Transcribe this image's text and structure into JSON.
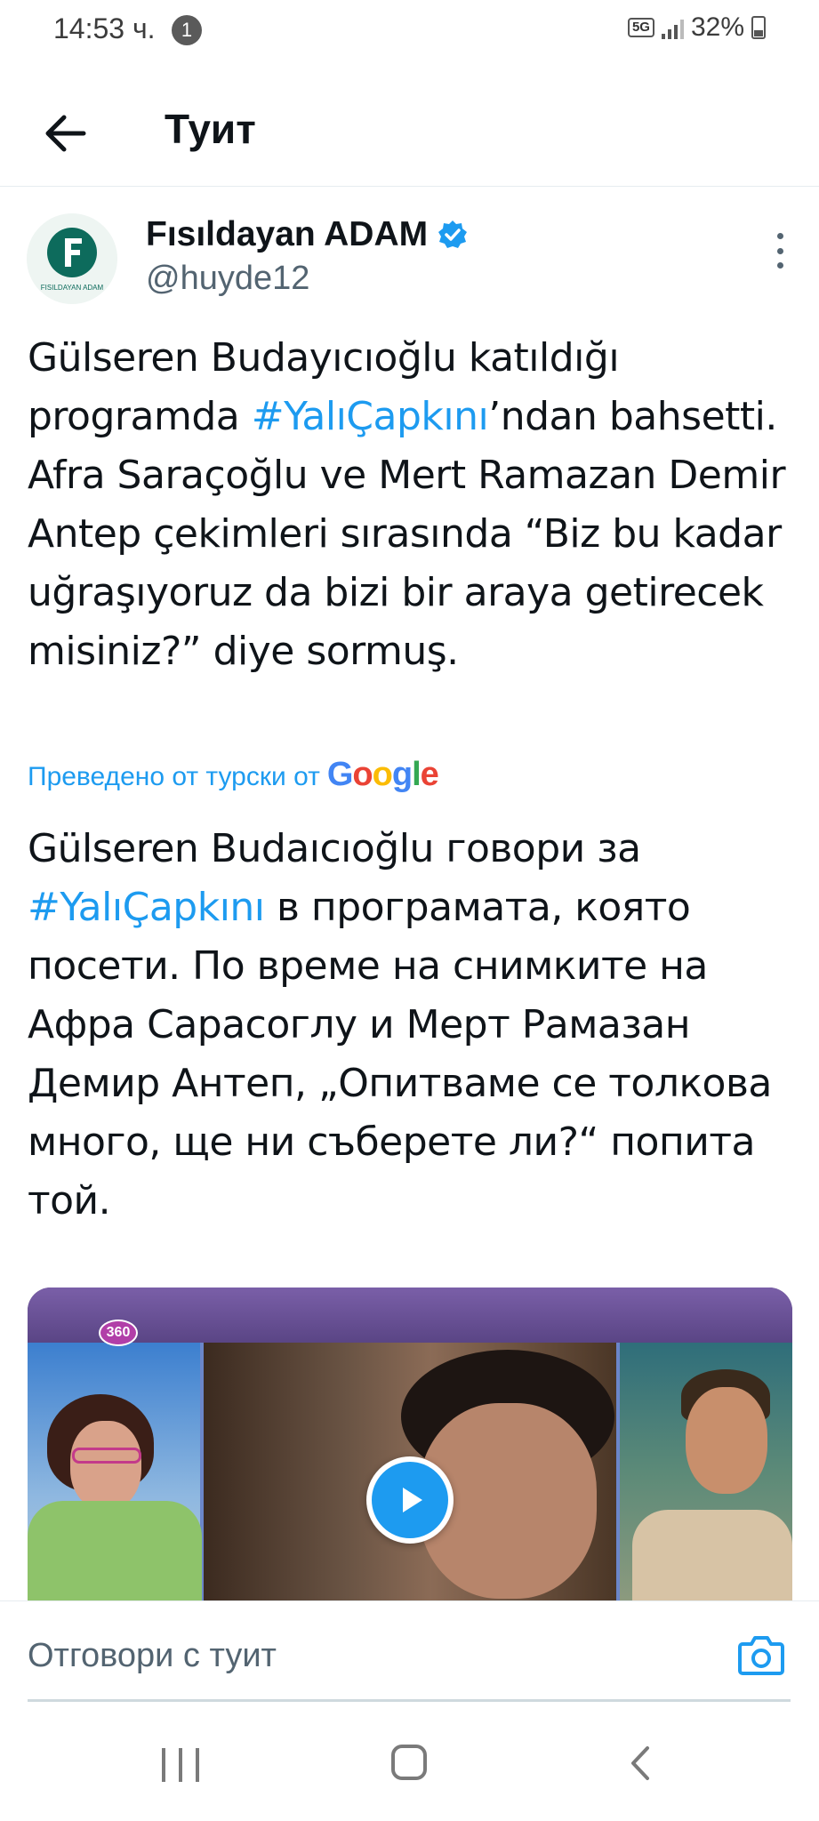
{
  "status_bar": {
    "time": "14:53 ч.",
    "notification_count": "1",
    "network": "5G",
    "battery": "32%"
  },
  "header": {
    "title": "Туит"
  },
  "tweet": {
    "author_name": "Fısıldayan ADAM",
    "author_handle": "@huyde12",
    "avatar_text": "FISILDAYAN ADAM",
    "text_part1": "Gülseren Budayıcıoğlu katıldığı programda ",
    "hashtag": "#YalıÇapkını",
    "text_part2": "’ndan bahsetti. Afra Saraçoğlu ve Mert Ramazan Demir Antep çekimleri sırasında “Biz bu kadar uğraşıyoruz da bizi bir araya getirecek misiniz?” diye sormuş.",
    "translated_by": "Преведено от турски от",
    "translator": "Google",
    "translation_part1": "Gülseren Budaıcıoğlu говори за ",
    "translation_hashtag": "#YalıÇapkını",
    "translation_part2": " в програмата, която посети. По време на снимките на Афра Сарасоглу и Мерт Рамазан Демир Антеп, „Опитваме се толкова много, ще ни съберете ли?“ попита той.",
    "media_logo": "360"
  },
  "reply": {
    "placeholder": "Отговори с туит"
  },
  "icons": {
    "back": "back-arrow-icon",
    "verified": "verified-badge-icon",
    "more": "more-vertical-icon",
    "play": "play-icon",
    "camera": "camera-icon"
  },
  "colors": {
    "accent": "#1d9bf0",
    "text": "#0f1419",
    "secondary": "#536471"
  }
}
